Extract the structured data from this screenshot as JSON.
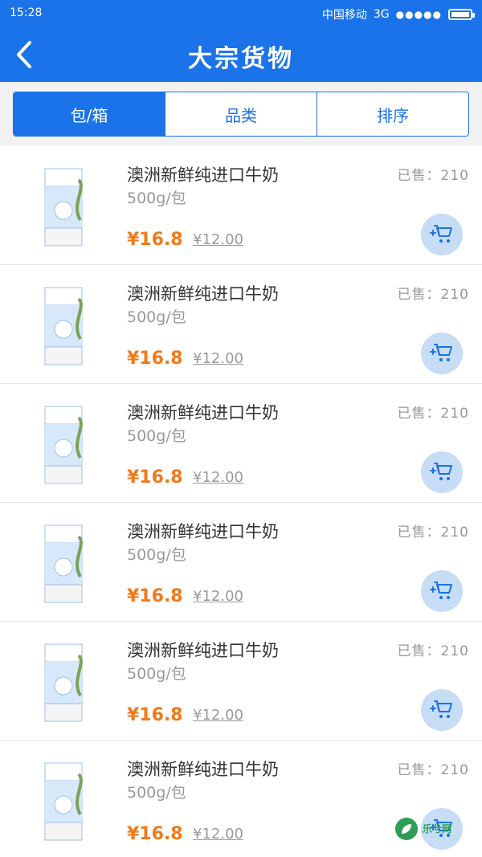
{
  "status": {
    "time": "15:28",
    "carrier": "中国移动",
    "network": "3G",
    "signal": "●●●●●"
  },
  "header": {
    "title": "大宗货物",
    "back_icon": "back-icon"
  },
  "filters": [
    {
      "label": "包/箱",
      "active": true
    },
    {
      "label": "品类",
      "active": false
    },
    {
      "label": "排序",
      "active": false
    }
  ],
  "products": [
    {
      "name": "澳洲新鲜纯进口牛奶",
      "spec": "500g/包",
      "sold": "已售：210",
      "price": "¥16.8",
      "old_price": "¥12.00"
    },
    {
      "name": "澳洲新鲜纯进口牛奶",
      "spec": "500g/包",
      "sold": "已售：210",
      "price": "¥16.8",
      "old_price": "¥12.00"
    },
    {
      "name": "澳洲新鲜纯进口牛奶",
      "spec": "500g/包",
      "sold": "已售：210",
      "price": "¥16.8",
      "old_price": "¥12.00"
    },
    {
      "name": "澳洲新鲜纯进口牛奶",
      "spec": "500g/包",
      "sold": "已售：210",
      "price": "¥16.8",
      "old_price": "¥12.00"
    },
    {
      "name": "澳洲新鲜纯进口牛奶",
      "spec": "500g/包",
      "sold": "已售：210",
      "price": "¥16.8",
      "old_price": "¥12.00"
    },
    {
      "name": "澳洲新鲜纯进口牛奶",
      "spec": "500g/包",
      "sold": "已售：210",
      "price": "¥16.8",
      "old_price": "¥12.00"
    }
  ],
  "watermark": {
    "text": "乐兮网",
    "icon": "leaf-logo-icon"
  },
  "colors": {
    "primary": "#1a73e8",
    "price": "#f07a1b",
    "cart_bg": "#c7ddf6"
  }
}
